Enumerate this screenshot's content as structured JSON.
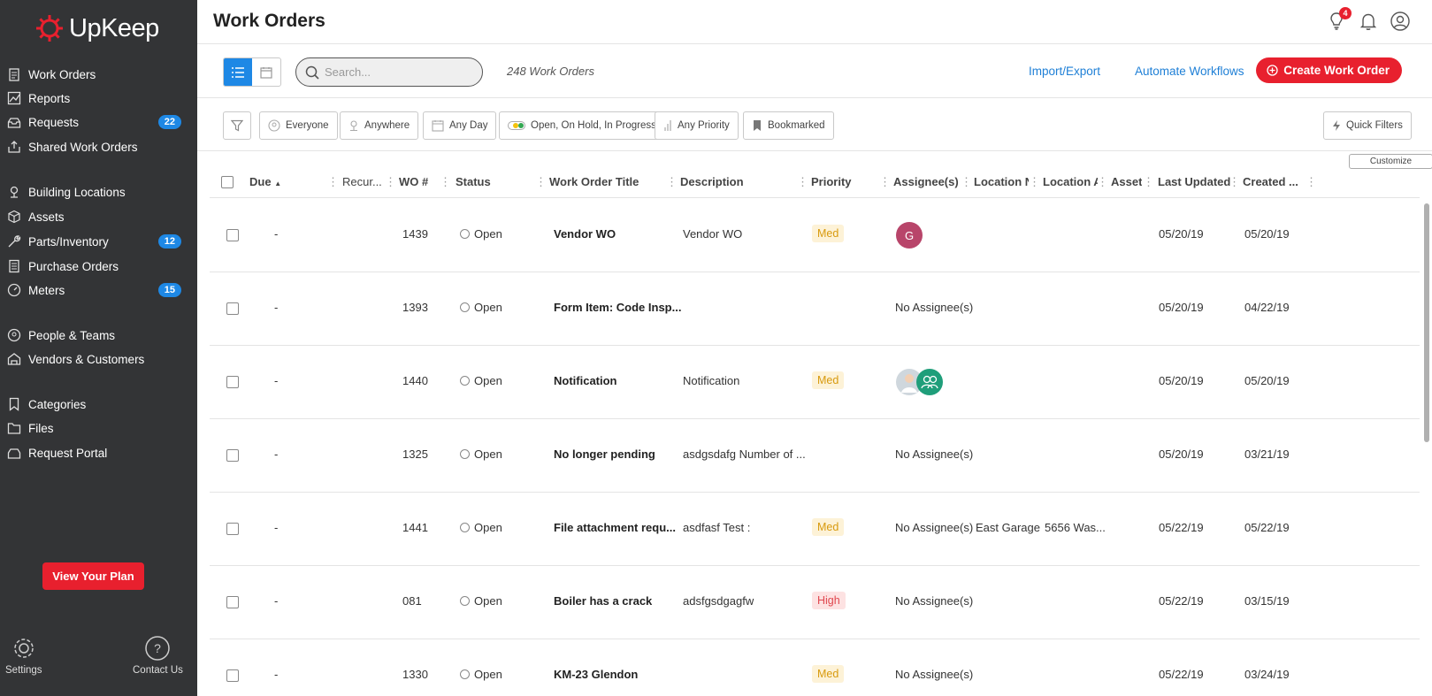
{
  "app": {
    "logo_text": "UpKeep"
  },
  "sidebar": {
    "items": [
      {
        "label": "Work Orders",
        "icon": "clipboard-icon"
      },
      {
        "label": "Reports",
        "icon": "chart-icon"
      },
      {
        "label": "Requests",
        "icon": "inbox-icon",
        "badge": "22"
      },
      {
        "label": "Shared Work Orders",
        "icon": "share-icon"
      },
      {
        "label": "Building Locations",
        "icon": "location-pin-icon"
      },
      {
        "label": "Assets",
        "icon": "cube-icon"
      },
      {
        "label": "Parts/Inventory",
        "icon": "wrench-icon",
        "badge": "12"
      },
      {
        "label": "Purchase Orders",
        "icon": "document-icon"
      },
      {
        "label": "Meters",
        "icon": "gauge-icon",
        "badge": "15"
      },
      {
        "label": "People & Teams",
        "icon": "people-icon"
      },
      {
        "label": "Vendors & Customers",
        "icon": "vendors-icon"
      },
      {
        "label": "Categories",
        "icon": "bookmark-icon"
      },
      {
        "label": "Files",
        "icon": "folder-icon"
      },
      {
        "label": "Request Portal",
        "icon": "portal-icon"
      }
    ],
    "plan_button": "View Your Plan",
    "settings_label": "Settings",
    "contact_label": "Contact Us"
  },
  "header": {
    "title": "Work Orders",
    "notification_count": "4"
  },
  "toolbar": {
    "search_placeholder": "Search...",
    "count_text": "248 Work Orders",
    "import_export": "Import/Export",
    "automate": "Automate Workflows",
    "create": "Create Work Order"
  },
  "filters": {
    "assignee": "Everyone",
    "location": "Anywhere",
    "date": "Any Day",
    "status": "Open, On Hold, In Progress",
    "priority": "Any Priority",
    "bookmarked": "Bookmarked",
    "quick": "Quick Filters"
  },
  "table": {
    "customize": "Customize",
    "columns": {
      "due": "Due",
      "recurrence": "Recur...",
      "wo_num": "WO #",
      "status": "Status",
      "title": "Work Order Title",
      "description": "Description",
      "priority": "Priority",
      "assignees": "Assignee(s)",
      "location_name": "Location N",
      "location_address": "Location A",
      "asset": "Asset",
      "last_updated": "Last Updated",
      "created": "Created ..."
    },
    "rows": [
      {
        "due": "-",
        "wo": "1439",
        "status": "Open",
        "title": "Vendor WO",
        "description": "Vendor WO",
        "priority": "Med",
        "assignee": "G",
        "location_name": "",
        "location_address": "",
        "updated": "05/20/19",
        "created": "05/20/19"
      },
      {
        "due": "-",
        "wo": "1393",
        "status": "Open",
        "title": "Form Item: Code Insp...",
        "description": "",
        "priority": "",
        "assignee": "No Assignee(s)",
        "location_name": "",
        "location_address": "",
        "updated": "05/20/19",
        "created": "04/22/19"
      },
      {
        "due": "-",
        "wo": "1440",
        "status": "Open",
        "title": "Notification",
        "description": "Notification",
        "priority": "Med",
        "assignee": "",
        "location_name": "",
        "location_address": "",
        "updated": "05/20/19",
        "created": "05/20/19"
      },
      {
        "due": "-",
        "wo": "1325",
        "status": "Open",
        "title": "No longer pending",
        "description": "asdgsdafg Number of ...",
        "priority": "",
        "assignee": "No Assignee(s)",
        "location_name": "",
        "location_address": "",
        "updated": "05/20/19",
        "created": "03/21/19"
      },
      {
        "due": "-",
        "wo": "1441",
        "status": "Open",
        "title": "File attachment requ...",
        "description": "asdfasf Test :",
        "priority": "Med",
        "assignee": "No Assignee(s)",
        "location_name": "East Garage",
        "location_address": "5656 Was...",
        "updated": "05/22/19",
        "created": "05/22/19"
      },
      {
        "due": "-",
        "wo": "081",
        "status": "Open",
        "title": "Boiler has a crack",
        "description": "adsfgsdgagfw",
        "priority": "High",
        "assignee": "No Assignee(s)",
        "location_name": "",
        "location_address": "",
        "updated": "05/22/19",
        "created": "03/15/19"
      },
      {
        "due": "-",
        "wo": "1330",
        "status": "Open",
        "title": "KM-23 Glendon",
        "description": "",
        "priority": "Med",
        "assignee": "No Assignee(s)",
        "location_name": "",
        "location_address": "",
        "updated": "05/22/19",
        "created": "03/24/19"
      }
    ]
  },
  "colors": {
    "accent": "#1e88e5",
    "brand": "#e8202e",
    "sidebar_bg": "#333436"
  }
}
